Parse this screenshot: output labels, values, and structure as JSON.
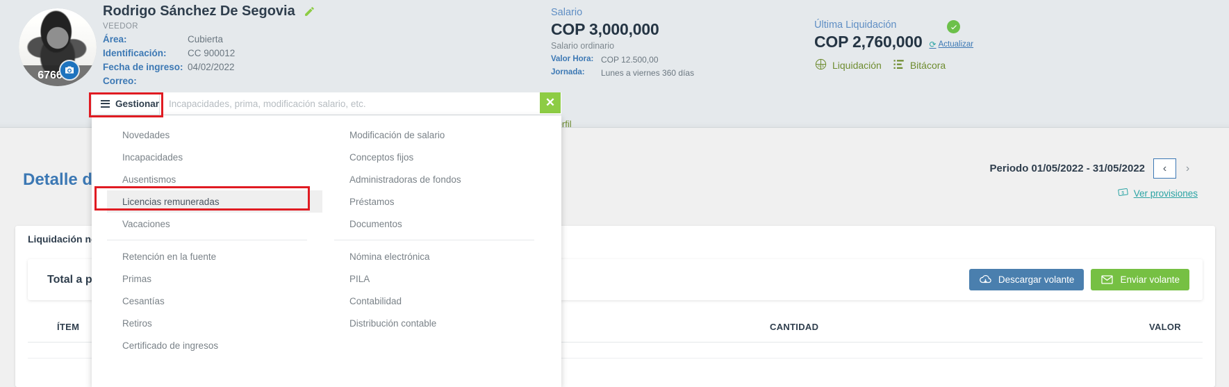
{
  "employee": {
    "name": "Rodrigo Sánchez De Segovia",
    "role": "VEEDOR",
    "avatar_number": "6766",
    "fields": [
      {
        "label": "Área:",
        "value": "Cubierta"
      },
      {
        "label": "Identificación:",
        "value": "CC 900012"
      },
      {
        "label": "Fecha de ingreso:",
        "value": "04/02/2022"
      },
      {
        "label": "Correo:",
        "value": ""
      }
    ]
  },
  "salary": {
    "label": "Salario",
    "amount": "COP 3,000,000",
    "subtitle": "Salario ordinario",
    "fields": [
      {
        "label": "Valor Hora:",
        "value": "COP 12.500,00"
      },
      {
        "label": "Jornada:",
        "value": "Lunes a viernes 360 días"
      }
    ]
  },
  "liquidation": {
    "label": "Última Liquidación",
    "amount": "COP 2,760,000",
    "update_link": "Actualizar",
    "refresh_glyph": "⟳",
    "actions": [
      {
        "label": "Liquidación",
        "icon": "liquidation-chart-icon"
      },
      {
        "label": "Bitácora",
        "icon": "log-list-icon"
      }
    ]
  },
  "search": {
    "gestionar_label": "Gestionar",
    "placeholder": "Incapacidades, prima, modificación salario, etc.",
    "value": "",
    "clear_glyph": "✕"
  },
  "menu": {
    "left_column": [
      {
        "label": "Novedades",
        "highlight": false
      },
      {
        "label": "Incapacidades",
        "highlight": false
      },
      {
        "label": "Ausentismos",
        "highlight": false
      },
      {
        "label": "Licencias remuneradas",
        "highlight": true
      },
      {
        "label": "Vacaciones",
        "highlight": false
      },
      {
        "separator": true
      },
      {
        "label": "Retención en la fuente",
        "highlight": false
      },
      {
        "label": "Primas",
        "highlight": false
      },
      {
        "label": "Cesantías",
        "highlight": false
      },
      {
        "label": "Retiros",
        "highlight": false
      },
      {
        "label": "Certificado de ingresos",
        "highlight": false
      }
    ],
    "right_column": [
      {
        "label": "Modificación de salario",
        "highlight": false
      },
      {
        "label": "Conceptos fijos",
        "highlight": false
      },
      {
        "label": "Administradoras de fondos",
        "highlight": false
      },
      {
        "label": "Préstamos",
        "highlight": false
      },
      {
        "label": "Documentos",
        "highlight": false
      },
      {
        "separator": true
      },
      {
        "label": "Nómina electrónica",
        "highlight": false
      },
      {
        "label": "PILA",
        "highlight": false
      },
      {
        "label": "Contabilidad",
        "highlight": false
      },
      {
        "label": "Distribución contable",
        "highlight": false
      }
    ]
  },
  "page": {
    "tab_perfil": "Perfil",
    "detalle_title": "Detalle de",
    "period_text": "Periodo 01/05/2022 - 31/05/2022",
    "prev_glyph": "‹",
    "next_glyph": "›",
    "ver_provisiones": "Ver provisiones",
    "card_tab": "Liquidación nó",
    "total_label": "Total a p",
    "btn_download": "Descargar volante",
    "btn_send": "Enviar volante",
    "table_headers": {
      "item": "ÍTEM",
      "cantidad": "CANTIDAD",
      "valor": "VALOR"
    }
  },
  "colors": {
    "accent_blue": "#3c78b4",
    "green": "#76c043",
    "teal": "#2aa3a3",
    "highlight_red": "#e01b22",
    "olive": "#6e8c2f"
  }
}
